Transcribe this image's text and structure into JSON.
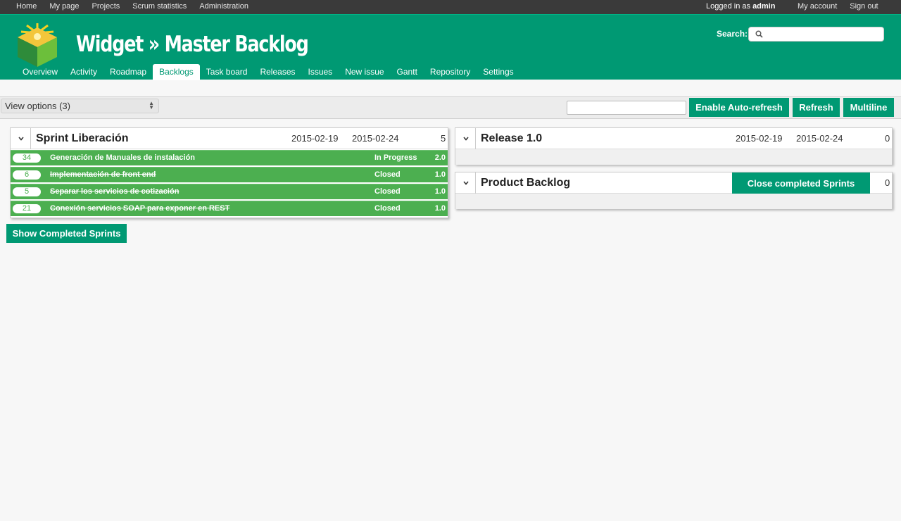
{
  "top_menu": {
    "left": [
      "Home",
      "My page",
      "Projects",
      "Scrum statistics",
      "Administration"
    ],
    "logged_in_prefix": "Logged in as",
    "user": "admin",
    "right": [
      "My account",
      "Sign out"
    ]
  },
  "header": {
    "title": "Widget » Master Backlog",
    "search_label": "Search:",
    "search_value": "",
    "logo_icon": "cube-logo-icon",
    "accent_color": "#009973"
  },
  "main_menu": {
    "tabs": [
      "Overview",
      "Activity",
      "Roadmap",
      "Backlogs",
      "Task board",
      "Releases",
      "Issues",
      "New issue",
      "Gantt",
      "Repository",
      "Settings"
    ],
    "selected": "Backlogs"
  },
  "toolbar": {
    "view_options": "View options (3)",
    "filter_value": "",
    "buttons": [
      "Enable Auto-refresh",
      "Refresh",
      "Multiline"
    ]
  },
  "sprint": {
    "name": "Sprint Liberación",
    "start": "2015-02-19",
    "end": "2015-02-24",
    "count": "5",
    "stories": [
      {
        "id": "34",
        "subject": "Generación de Manuales de instalación",
        "status": "In Progress",
        "points": "2.0",
        "closed": false
      },
      {
        "id": "6",
        "subject": "Implementación de front end",
        "status": "Closed",
        "points": "1.0",
        "closed": true
      },
      {
        "id": "5",
        "subject": "Separar los servicios de cotización",
        "status": "Closed",
        "points": "1.0",
        "closed": true
      },
      {
        "id": "21",
        "subject": "Conexión servicios SOAP para exponer en REST",
        "status": "Closed",
        "points": "1.0",
        "closed": true
      }
    ],
    "story_color": "#4caf50"
  },
  "show_completed_label": "Show Completed Sprints",
  "release": {
    "name": "Release 1.0",
    "start": "2015-02-19",
    "end": "2015-02-24",
    "count": "0"
  },
  "product_backlog": {
    "name": "Product Backlog",
    "close_button": "Close completed Sprints",
    "count": "0"
  }
}
